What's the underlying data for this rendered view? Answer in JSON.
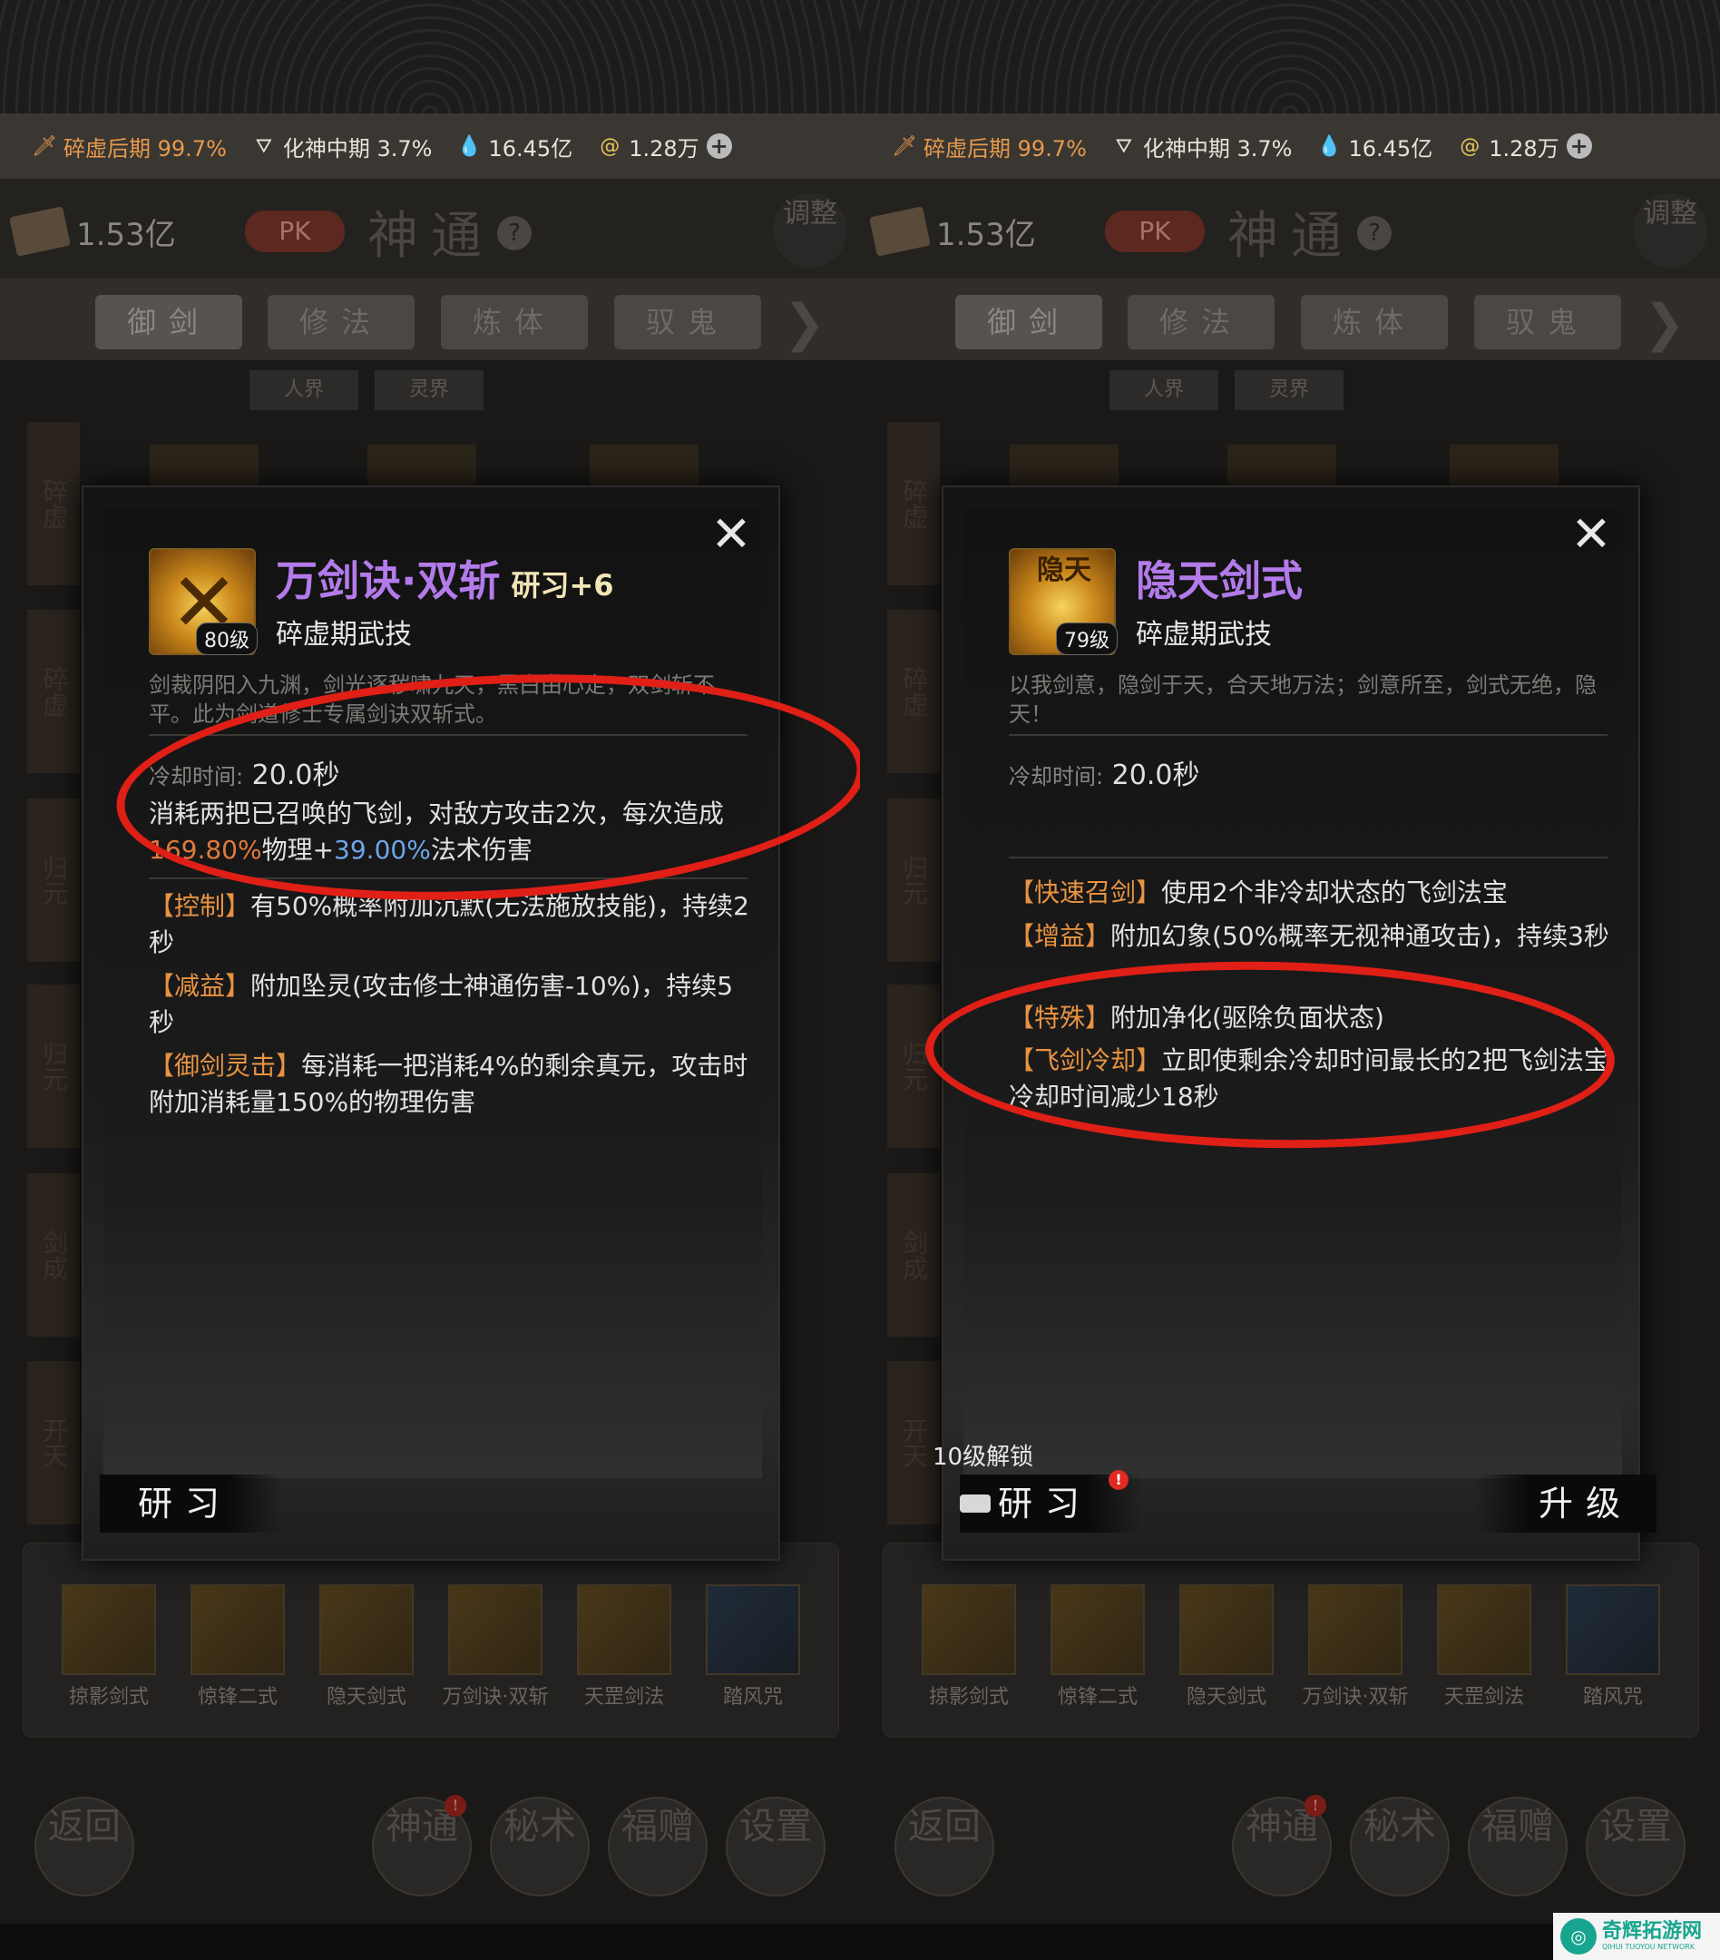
{
  "resource_bar": {
    "realm1": "碎虚后期 99.7%",
    "realm2": "化神中期 3.7%",
    "spirit_stones": "16.45亿",
    "currency": "1.28万",
    "icons": [
      "sword-icon",
      "fan-icon",
      "water-drop-icon",
      "coin-icon",
      "plus-icon"
    ]
  },
  "header": {
    "power": "1.53亿",
    "pk": "PK",
    "title": "神通",
    "help": "?",
    "adjust": "调整"
  },
  "tabs": [
    "御剑",
    "修法",
    "炼体",
    "驭鬼"
  ],
  "subtabs": [
    "人界",
    "灵界"
  ],
  "sidebar_tags": [
    "碎虚",
    "碎虚",
    "归元",
    "归元",
    "剑成",
    "开天"
  ],
  "skills_bar": [
    "掠影剑式",
    "惊锋二式",
    "隐天剑式",
    "万剑诀·双斩",
    "天罡剑法",
    "踏风咒"
  ],
  "bottom_nav": [
    "返回",
    "神通",
    "秘术",
    "福赠",
    "设置"
  ],
  "nav_badge": "!",
  "left_modal": {
    "name": "万剑诀·双斩",
    "study_level": "研习+6",
    "level": "80级",
    "type": "碎虚期武技",
    "desc": "剑裁阴阳入九渊，剑光逐秽啸九天，黑白由心定，双剑斩不平。此为剑道修士专属剑诀双斩式。",
    "cd_label": "冷却时间:",
    "cd_value": "20.0秒",
    "main_effect_a": "消耗两把已召唤的飞剑，对敌方攻击2次，每次造成",
    "main_effect_phy": "169.80%",
    "main_effect_phy_txt": "物理+",
    "main_effect_mag": "39.00%",
    "main_effect_mag_txt": "法术伤害",
    "effects": [
      {
        "tag": "【控制】",
        "text": "有50%概率附加沉默(无法施放技能)，持续2秒"
      },
      {
        "tag": "【减益】",
        "text": "附加坠灵(攻击修士神通伤害-10%)，持续5秒"
      },
      {
        "tag": "【御剑灵击】",
        "text": "每消耗一把消耗4%的剩余真元，攻击时附加消耗量150%的物理伤害"
      }
    ],
    "study_button": "研习"
  },
  "right_modal": {
    "name": "隐天剑式",
    "level": "79级",
    "icon_glyph": "隐天",
    "type": "碎虚期武技",
    "desc": "以我剑意，隐剑于天，合天地万法；剑意所至，剑式无绝，隐天！",
    "cd_label": "冷却时间:",
    "cd_value": "20.0秒",
    "effects": [
      {
        "tag": "【快速召剑】",
        "text": "使用2个非冷却状态的飞剑法宝"
      },
      {
        "tag": "【增益】",
        "text": "附加幻象(50%概率无视神通攻击)，持续3秒"
      },
      {
        "tag": "【特殊】",
        "text": "附加净化(驱除负面状态)"
      },
      {
        "tag": "【飞剑冷却】",
        "text": "立即使剩余冷却时间最长的2把飞剑法宝冷却时间减少18秒"
      }
    ],
    "unlock_text": "10级解锁",
    "study_button": "研习",
    "upgrade_button": "升级",
    "badge": "!"
  },
  "watermark": {
    "name": "奇辉拓游网",
    "sub": "QIHUI TUOYOU NETWORK"
  },
  "colors": {
    "skill_name": "#b37bea",
    "effect_tag": "#e89342",
    "physical": "#e07a3c",
    "magic": "#6fa5e8",
    "annotation": "#e01f17"
  }
}
